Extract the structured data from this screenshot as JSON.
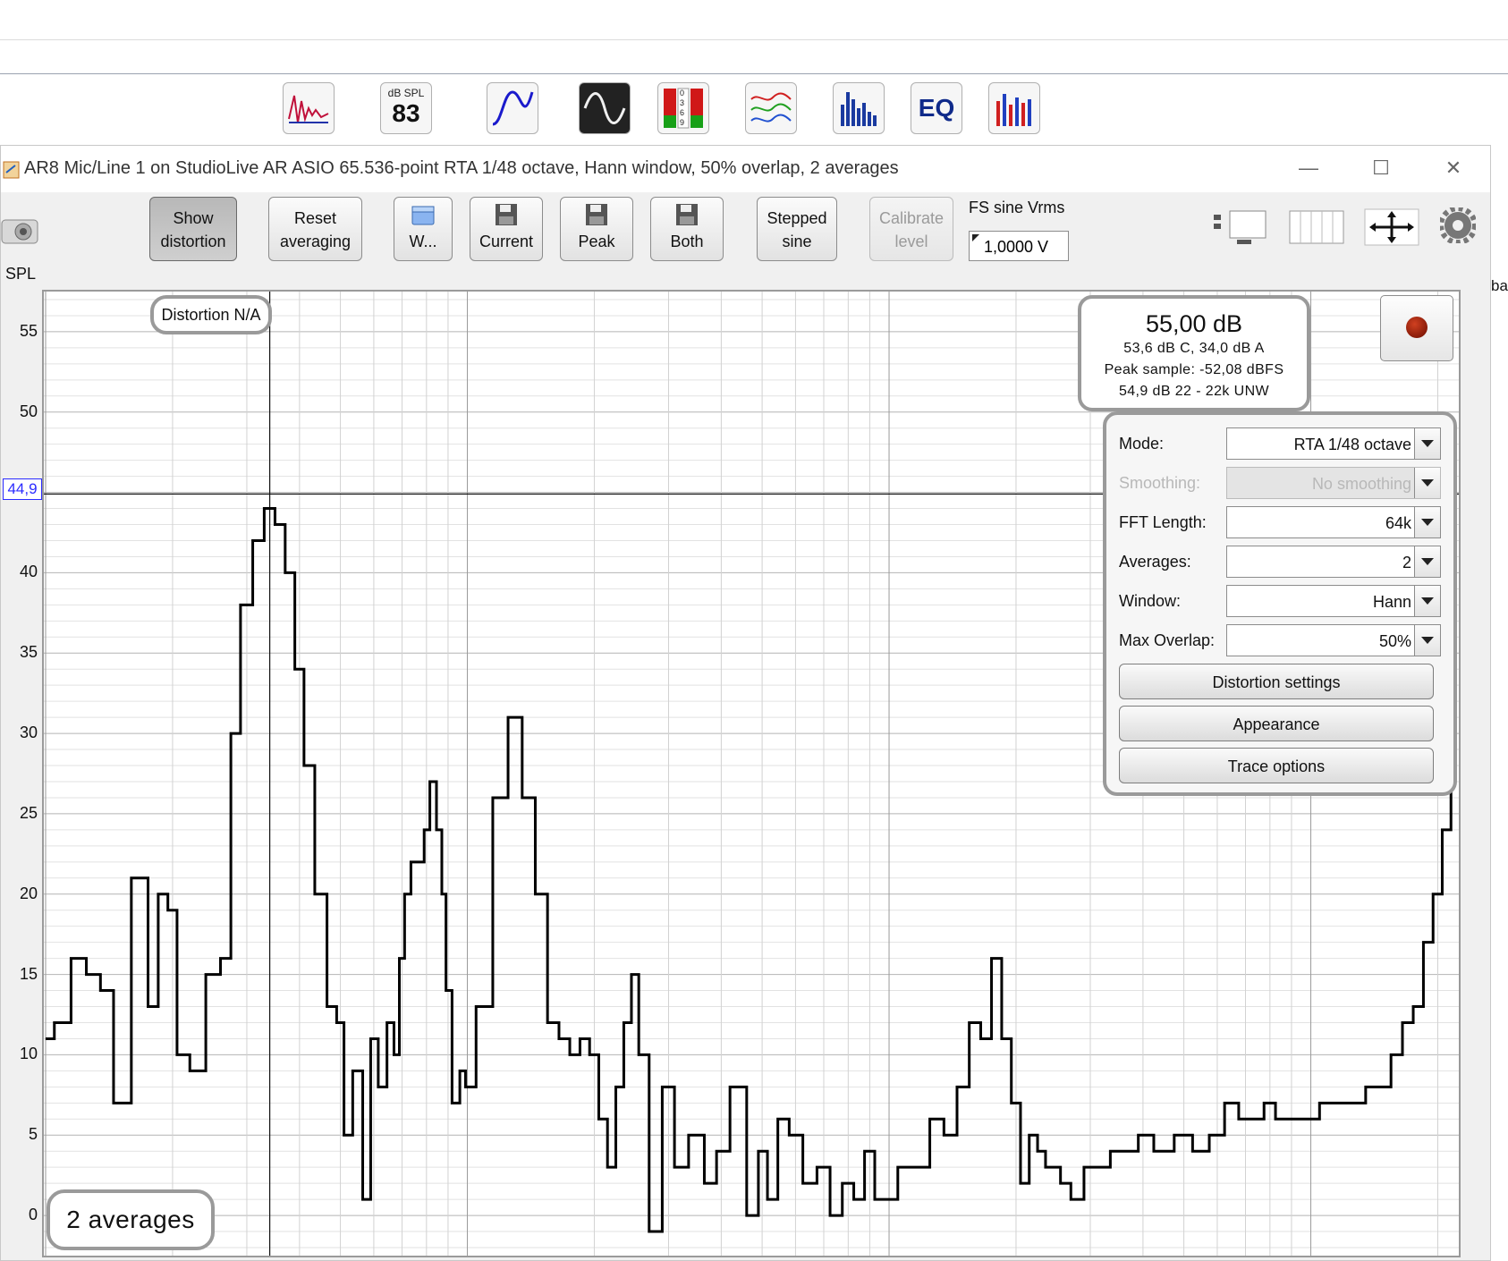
{
  "toolbar_icons": [
    {
      "name": "impulse-icon"
    },
    {
      "name": "spl-meter-icon",
      "top_label": "dB SPL",
      "value": "83"
    },
    {
      "name": "generator-icon"
    },
    {
      "name": "scope-icon"
    },
    {
      "name": "level-meters-icon",
      "digits": "0369"
    },
    {
      "name": "overlays-icon"
    },
    {
      "name": "rta-icon"
    },
    {
      "name": "eq-icon",
      "label": "EQ"
    },
    {
      "name": "room-sim-icon"
    }
  ],
  "window": {
    "title": "AR8 Mic/Line 1 on StudioLive AR ASIO 65.536-point RTA 1/48 octave, Hann window, 50% overlap, 2 averages",
    "minimize": "—",
    "maximize": "☐",
    "close": "✕"
  },
  "buttons": {
    "show_distortion": [
      "Show",
      "distortion"
    ],
    "reset_averaging": [
      "Reset",
      "averaging"
    ],
    "w": "W...",
    "current": "Current",
    "peak": "Peak",
    "both": "Both",
    "stepped_sine": [
      "Stepped",
      "sine"
    ],
    "calibrate_level": [
      "Calibrate",
      "level"
    ]
  },
  "fs_sine": {
    "label": "FS sine Vrms",
    "value": "1,0000 V"
  },
  "axis": {
    "title": "SPL",
    "ticks": [
      "55",
      "50",
      "45",
      "40",
      "35",
      "30",
      "25",
      "20",
      "15",
      "10",
      "5",
      "0"
    ],
    "cursor_value": "44,9"
  },
  "overlays": {
    "distortion": "Distortion N/A",
    "averages": "2 averages",
    "level_main": "55,00 dB",
    "level_weighted": "53,6 dB C, 34,0 dB A",
    "peak_sample": "Peak sample: -52,08 dBFS",
    "unweighted": "54,9 dB 22 - 22k UNW"
  },
  "settings": {
    "rows": [
      {
        "label": "Mode:",
        "value": "RTA 1/48 octave",
        "enabled": true
      },
      {
        "label": "Smoothing:",
        "value": "No  smoothing",
        "enabled": false
      },
      {
        "label": "FFT Length:",
        "value": "64k",
        "enabled": true
      },
      {
        "label": "Averages:",
        "value": "2",
        "enabled": true
      },
      {
        "label": "Window:",
        "value": "Hann",
        "enabled": true
      },
      {
        "label": "Max Overlap:",
        "value": "50%",
        "enabled": true
      }
    ],
    "distortion_settings": "Distortion settings",
    "appearance": "Appearance",
    "trace_options": "Trace options"
  },
  "right_fragment": "ba",
  "chart_data": {
    "type": "line",
    "ylabel": "SPL",
    "ylim": [
      -2.5,
      57.5
    ],
    "yticks": [
      0,
      5,
      10,
      15,
      20,
      25,
      30,
      35,
      40,
      45,
      50,
      55
    ],
    "x": [
      10,
      11,
      12,
      13,
      14,
      15,
      17,
      18,
      19,
      20,
      21,
      23,
      25,
      27,
      28,
      30,
      32,
      34,
      36,
      38,
      40,
      42,
      45,
      48,
      50,
      52,
      55,
      58,
      60,
      63,
      66,
      68,
      70,
      72,
      75,
      78,
      80,
      83,
      86,
      88,
      90,
      94,
      98,
      100,
      110,
      120,
      130,
      140,
      150,
      160,
      170,
      180,
      190,
      200,
      210,
      220,
      230,
      240,
      250,
      260,
      280,
      300,
      320,
      350,
      380,
      400,
      440,
      480,
      500,
      530,
      560,
      600,
      650,
      700,
      750,
      800,
      850,
      900,
      950,
      1000,
      1100,
      1200,
      1300,
      1400,
      1500,
      1600,
      1700,
      1800,
      1900,
      2000,
      2100,
      2200,
      2300,
      2400,
      2500,
      2600,
      2800,
      3000,
      3200,
      3500,
      3800,
      4000,
      4500,
      5000,
      5500,
      6000,
      6500,
      7000,
      7500,
      8000,
      8500,
      9000,
      9500,
      10000,
      11000,
      12000,
      13000,
      14000,
      15000,
      16000,
      17000,
      18000,
      19000,
      20000,
      21000,
      22000
    ],
    "series": [
      {
        "values": [
          11,
          12,
          16,
          15,
          14,
          7,
          21,
          13,
          20,
          19,
          10,
          9,
          15,
          16,
          30,
          38,
          42,
          44,
          43,
          40,
          34,
          28,
          20,
          13,
          12,
          5,
          9,
          1,
          11,
          8,
          12,
          10,
          16,
          20,
          22,
          22,
          24,
          27,
          24,
          20,
          14,
          7,
          9,
          8,
          13,
          26,
          31,
          26,
          20,
          12,
          11,
          10,
          11,
          10,
          6,
          3,
          8,
          12,
          15,
          10,
          -1,
          8,
          3,
          5,
          2,
          4,
          8,
          0,
          4,
          1,
          6,
          5,
          2,
          3,
          0,
          2,
          1,
          4,
          1,
          1,
          3,
          3,
          6,
          5,
          8,
          12,
          11,
          16,
          11,
          7,
          2,
          5,
          4,
          3,
          3,
          2,
          1,
          3,
          3,
          4,
          4,
          5,
          4,
          5,
          4,
          5,
          7,
          6,
          6,
          7,
          6,
          6,
          6,
          6,
          7,
          7,
          7,
          8,
          8,
          10,
          12,
          13,
          17,
          20,
          24,
          30
        ]
      }
    ]
  }
}
